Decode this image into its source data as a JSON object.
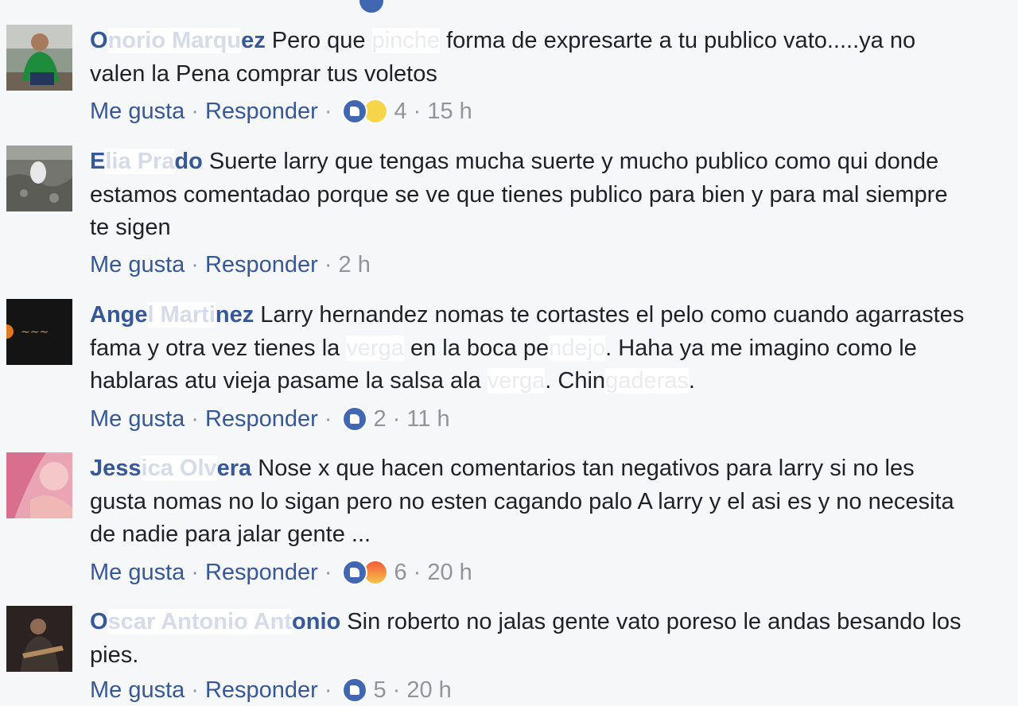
{
  "colors": {
    "name": "#365899",
    "text": "#1d2129",
    "meta": "#90949c",
    "like": "#4267b2",
    "background": "#f6f7f9"
  },
  "actions": {
    "like": "Me gusta",
    "reply": "Responder",
    "sep": "·"
  },
  "comments": [
    {
      "name_visible_a": "O",
      "name_redacted": "norio Marqu",
      "name_visible_b": "ez",
      "text_before": " Pero que ",
      "text_redacted": "pinche",
      "text_after": " forma de expresarte a tu publico vato.....ya no valen la Pena comprar tus voletos",
      "reactions": [
        "like",
        "wow"
      ],
      "count": "4",
      "time": "15 h",
      "avatar": "man-green-shirt"
    },
    {
      "name_visible_a": "E",
      "name_redacted": "lia Pra",
      "name_visible_b": "do",
      "text": " Suerte larry que tengas mucha suerte y mucho publico como qui donde estamos comentadao porque se ve que tienes publico para bien y para mal siempre te sigen",
      "reactions": [],
      "count": "",
      "time": "2 h",
      "avatar": "bird-rocks"
    },
    {
      "name_visible_a": "Ange",
      "name_redacted": "l Marti",
      "name_visible_b": "nez",
      "text_1": " Larry hernandez nomas te cortastes el pelo como cuando agarrastes fama y otra vez tienes la ",
      "text_redacted_1": "verga",
      "text_2": " en la boca pe",
      "text_redacted_2": "ndejo",
      "text_3": ". Haha ya me imagino como le hablaras atu vieja pasame la salsa ala ",
      "text_redacted_3": "verga",
      "text_4": ". Chin",
      "text_redacted_4": "gaderas",
      "text_5": ".",
      "reactions": [
        "like"
      ],
      "count": "2",
      "time": "11 h",
      "avatar": "dark-logo"
    },
    {
      "name_visible_a": "Jess",
      "name_redacted": "ica Olv",
      "name_visible_b": "era",
      "text": " Nose x que hacen comentarios tan negativos para larry si no les gusta nomas no lo sigan pero no esten cagando palo A larry y el asi es y no necesita de nadie para jalar gente ...",
      "reactions": [
        "like",
        "angry"
      ],
      "count": "6",
      "time": "20 h",
      "avatar": "pink-photo"
    },
    {
      "name_visible_a": "O",
      "name_redacted": "scar Antonio Ant",
      "name_visible_b": "onio",
      "text": " Sin roberto no jalas gente vato poreso le andas besando los pies.",
      "reactions": [
        "like"
      ],
      "count": "5",
      "time": "20 h",
      "avatar": "man-guitar"
    }
  ]
}
